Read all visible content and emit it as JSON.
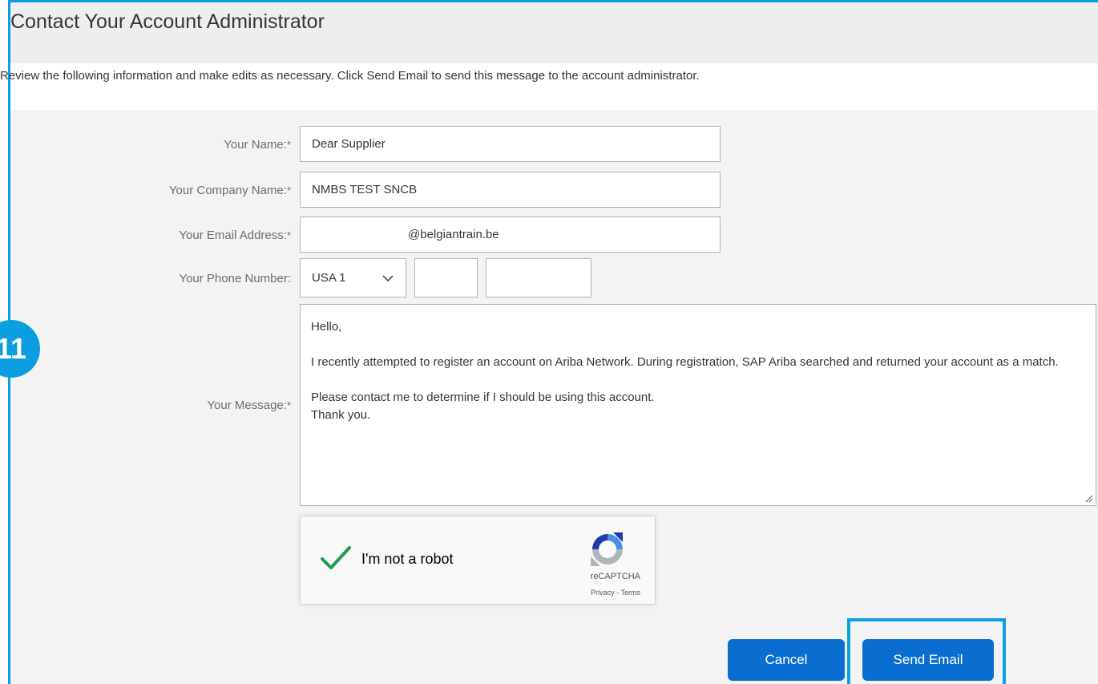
{
  "page": {
    "title": "Contact Your Account Administrator",
    "instructions": "Review the following information and make edits as necessary. Click Send Email to send this message to the account administrator."
  },
  "step_badge": "11",
  "form": {
    "required_marker": "*",
    "name": {
      "label": "Your Name:",
      "value": "Dear Supplier"
    },
    "company": {
      "label": "Your Company Name:",
      "value": "NMBS TEST SNCB"
    },
    "email": {
      "label": "Your Email Address:",
      "value": "@belgiantrain.be"
    },
    "phone": {
      "label": "Your Phone Number:",
      "country": "USA 1",
      "area_code": "",
      "number": ""
    },
    "message": {
      "label": "Your Message:",
      "lines": [
        "Hello,",
        "I recently attempted to register an account on Ariba Network. During registration, SAP Ariba searched and returned your account as a match.",
        "Please contact me to determine if I should be using this account.",
        "Thank you."
      ]
    }
  },
  "captcha": {
    "label": "I'm not a robot",
    "brand": "reCAPTCHA",
    "links": "Privacy - Terms",
    "checked": true
  },
  "buttons": {
    "cancel": "Cancel",
    "send": "Send Email"
  },
  "colors": {
    "accent": "#0a9ee0",
    "button": "#0a6ed1",
    "check": "#1e9e4a"
  }
}
